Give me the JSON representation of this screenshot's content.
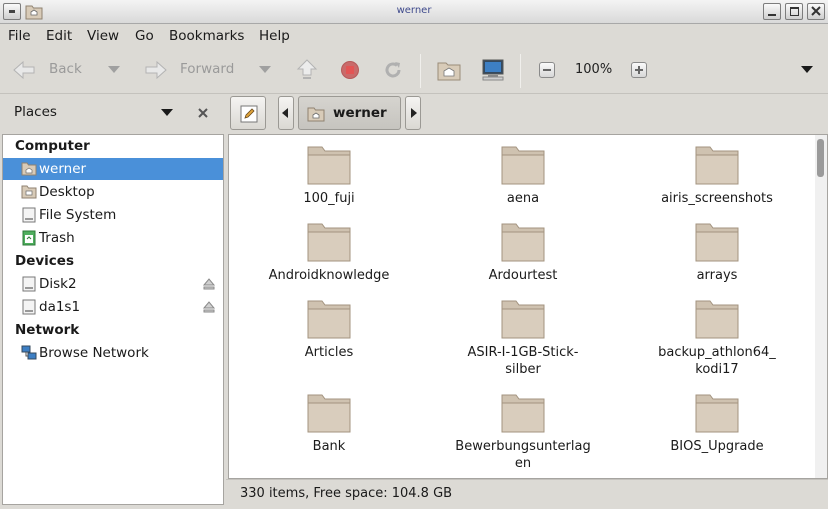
{
  "window": {
    "title": "werner"
  },
  "menu": [
    "File",
    "Edit",
    "View",
    "Go",
    "Bookmarks",
    "Help"
  ],
  "toolbar": {
    "back_label": "Back",
    "forward_label": "Forward",
    "zoom_label": "100%"
  },
  "places": {
    "title": "Places"
  },
  "pathbar": {
    "current": "werner"
  },
  "sidebar": {
    "sections": [
      {
        "heading": "Computer",
        "items": [
          {
            "label": "werner",
            "icon": "home-folder-icon",
            "selected": true
          },
          {
            "label": "Desktop",
            "icon": "desktop-folder-icon"
          },
          {
            "label": "File System",
            "icon": "drive-icon"
          },
          {
            "label": "Trash",
            "icon": "trash-icon"
          }
        ]
      },
      {
        "heading": "Devices",
        "items": [
          {
            "label": "Disk2",
            "icon": "drive-icon",
            "eject": true
          },
          {
            "label": "da1s1",
            "icon": "drive-icon",
            "eject": true
          }
        ]
      },
      {
        "heading": "Network",
        "items": [
          {
            "label": "Browse Network",
            "icon": "network-icon"
          }
        ]
      }
    ]
  },
  "files": [
    {
      "name": "100_fuji"
    },
    {
      "name": "aena"
    },
    {
      "name": "airis_screenshots"
    },
    {
      "name": "Androidknowledge"
    },
    {
      "name": "Ardourtest"
    },
    {
      "name": "arrays"
    },
    {
      "name": "Articles"
    },
    {
      "name": "ASIR-I-1GB-Stick-\nsilber"
    },
    {
      "name": "backup_athlon64_\nkodi17"
    },
    {
      "name": "Bank"
    },
    {
      "name": "Bewerbungsunterlag\nen"
    },
    {
      "name": "BIOS_Upgrade"
    }
  ],
  "status": {
    "text": "330 items, Free space: 104.8 GB"
  },
  "colors": {
    "selection": "#4a90d9",
    "folder": "#cfc2b0"
  }
}
